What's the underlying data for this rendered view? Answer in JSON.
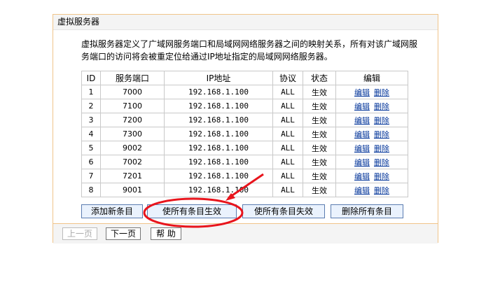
{
  "panel": {
    "title": "虚拟服务器",
    "description": "虚拟服务器定义了广域网服务端口和局域网网络服务器之间的映射关系，所有对该广域网服务端口的访问将会被重定位给通过IP地址指定的局域网网络服务器。"
  },
  "table": {
    "headers": [
      "ID",
      "服务端口",
      "IP地址",
      "协议",
      "状态",
      "编辑"
    ],
    "rows": [
      {
        "id": "1",
        "port": "7000",
        "ip": "192.168.1.100",
        "proto": "ALL",
        "status": "生效",
        "edit": "编辑",
        "del": "删除"
      },
      {
        "id": "2",
        "port": "7100",
        "ip": "192.168.1.100",
        "proto": "ALL",
        "status": "生效",
        "edit": "编辑",
        "del": "删除"
      },
      {
        "id": "3",
        "port": "7200",
        "ip": "192.168.1.100",
        "proto": "ALL",
        "status": "生效",
        "edit": "编辑",
        "del": "删除"
      },
      {
        "id": "4",
        "port": "7300",
        "ip": "192.168.1.100",
        "proto": "ALL",
        "status": "生效",
        "edit": "编辑",
        "del": "删除"
      },
      {
        "id": "5",
        "port": "9002",
        "ip": "192.168.1.100",
        "proto": "ALL",
        "status": "生效",
        "edit": "编辑",
        "del": "删除"
      },
      {
        "id": "6",
        "port": "7002",
        "ip": "192.168.1.100",
        "proto": "ALL",
        "status": "生效",
        "edit": "编辑",
        "del": "删除"
      },
      {
        "id": "7",
        "port": "7201",
        "ip": "192.168.1.100",
        "proto": "ALL",
        "status": "生效",
        "edit": "编辑",
        "del": "删除"
      },
      {
        "id": "8",
        "port": "9001",
        "ip": "192.168.1.100",
        "proto": "ALL",
        "status": "生效",
        "edit": "编辑",
        "del": "删除"
      }
    ]
  },
  "actions": {
    "add": "添加新条目",
    "enable_all": "使所有条目生效",
    "disable_all": "使所有条目失效",
    "delete_all": "删除所有条目"
  },
  "nav": {
    "prev": "上一页",
    "next": "下一页",
    "help": "帮 助"
  },
  "annotation": {
    "color": "#e8141c"
  }
}
